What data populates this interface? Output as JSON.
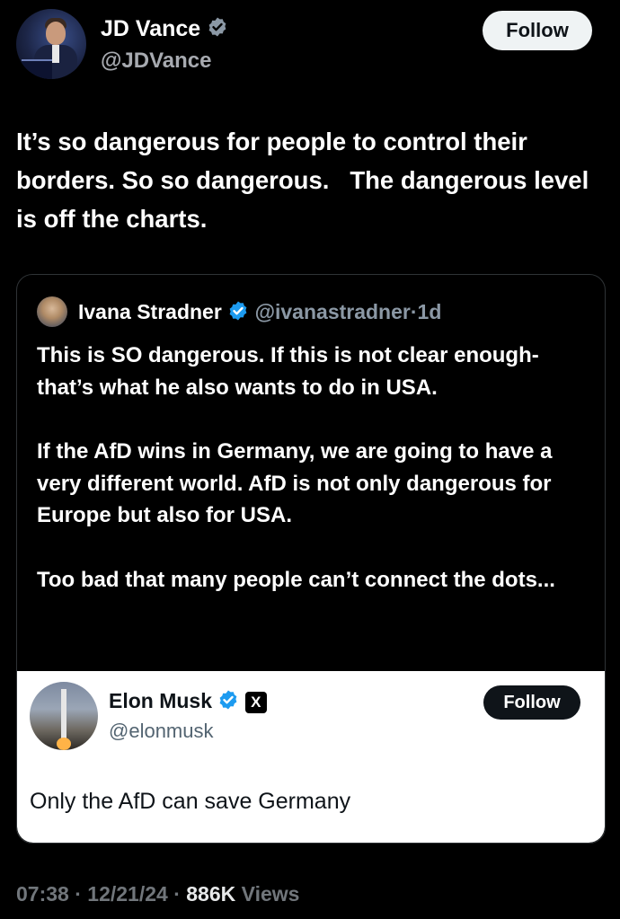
{
  "author": {
    "name": "JD Vance",
    "handle": "@JDVance",
    "follow_label": "Follow"
  },
  "tweet": {
    "text": "It’s so dangerous for people to control their borders. So so dangerous.   The dangerous level is off the charts."
  },
  "quote": {
    "name": "Ivana Stradner",
    "handle": "@ivanastradner",
    "separator": "·",
    "age": "1d",
    "paragraphs": [
      "This is SO dangerous. If this is not clear enough- that’s what he also wants to do in USA.",
      "If the AfD wins in Germany, we are going to have a very different world. AfD is not only dangerous for Europe but also for USA.",
      "Too bad that many people can’t connect the dots..."
    ],
    "embedded": {
      "name": "Elon Musk",
      "handle": "@elonmusk",
      "follow_label": "Follow",
      "x_glyph": "X",
      "text": "Only the AfD can save Germany"
    }
  },
  "meta": {
    "time": "07:38",
    "date": "12/21/24",
    "separator": "·",
    "views_count": "886K",
    "views_label": "Views"
  },
  "colors": {
    "verified_blue": "#1d9bf0",
    "muted_gray": "#71767b"
  },
  "icons": [
    "verified-badge-icon",
    "x-logo-icon"
  ]
}
